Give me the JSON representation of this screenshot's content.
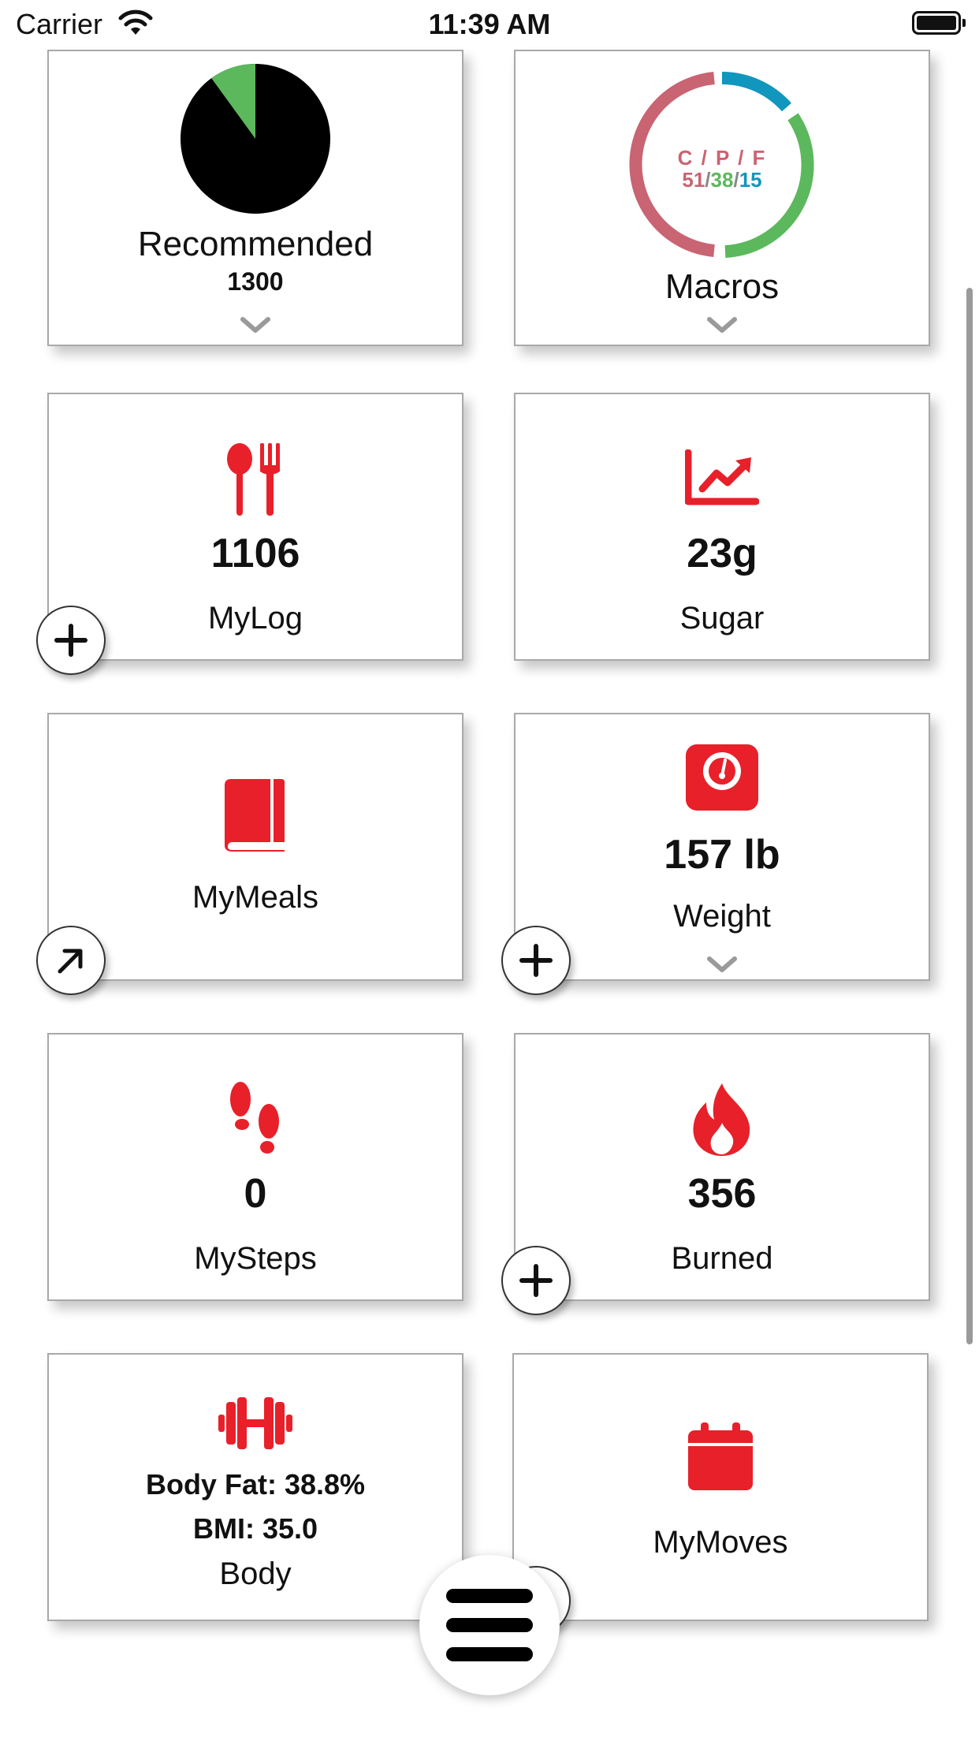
{
  "status_bar": {
    "carrier": "Carrier",
    "time": "11:39 AM"
  },
  "colors": {
    "accent_red": "#e8202a",
    "carbs": "#c96472",
    "protein": "#5cb85c",
    "fat": "#1196bd"
  },
  "cards": {
    "recommended": {
      "label": "Recommended",
      "value": "1300",
      "pie_green_fraction": 0.1
    },
    "macros": {
      "label": "Macros",
      "header": "C / P / F",
      "c": "51",
      "p": "38",
      "f": "15",
      "sep": "/"
    },
    "mylog": {
      "value": "1106",
      "label": "MyLog",
      "icon": "utensils-icon"
    },
    "sugar": {
      "value": "23g",
      "label": "Sugar",
      "icon": "chart-line-icon"
    },
    "mymeals": {
      "label": "MyMeals",
      "icon": "book-icon"
    },
    "weight": {
      "value": "157 lb",
      "label": "Weight",
      "icon": "scale-icon"
    },
    "mysteps": {
      "value": "0",
      "label": "MySteps",
      "icon": "footprints-icon"
    },
    "burned": {
      "value": "356",
      "label": "Burned",
      "icon": "flame-icon"
    },
    "body": {
      "body_fat": "Body Fat: 38.8%",
      "bmi": "BMI: 35.0",
      "label": "Body",
      "icon": "dumbbell-icon"
    },
    "mymoves": {
      "label": "MyMoves",
      "icon": "calendar-icon"
    }
  }
}
